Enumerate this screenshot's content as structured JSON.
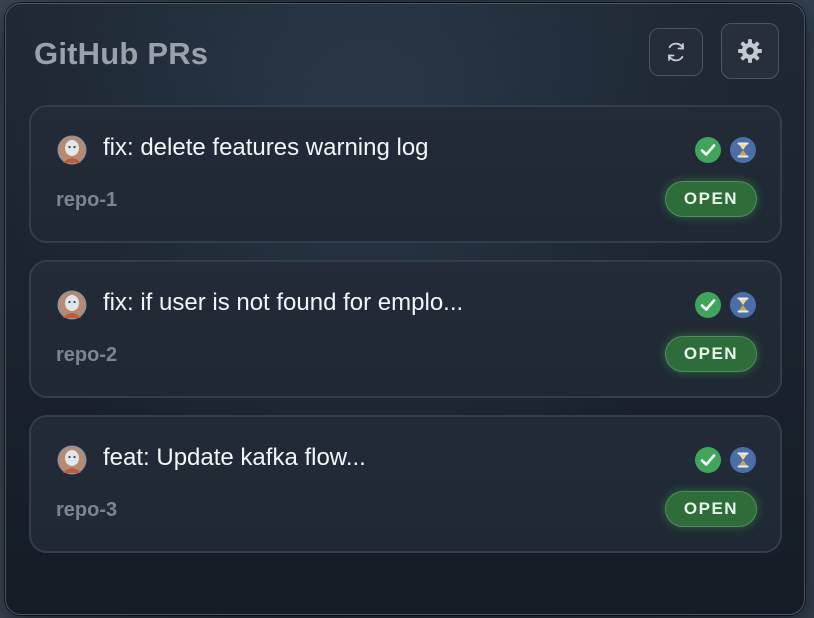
{
  "header": {
    "title": "GitHub PRs",
    "refresh_icon": "refresh-icon",
    "settings_icon": "gear-icon"
  },
  "pull_requests": [
    {
      "title": "fix: delete features warning log",
      "repo": "repo-1",
      "status": "OPEN",
      "check_icon": "check-icon",
      "review_icon": "hourglass-icon"
    },
    {
      "title": "fix: if user is not found for emplo...",
      "repo": "repo-2",
      "status": "OPEN",
      "check_icon": "check-icon",
      "review_icon": "hourglass-icon"
    },
    {
      "title": "feat: Update kafka flow...",
      "repo": "repo-3",
      "status": "OPEN",
      "check_icon": "check-icon",
      "review_icon": "hourglass-icon"
    }
  ],
  "colors": {
    "open_badge": "#2e6d3a",
    "check": "#3fa55b",
    "pending": "#4a6fa8"
  }
}
